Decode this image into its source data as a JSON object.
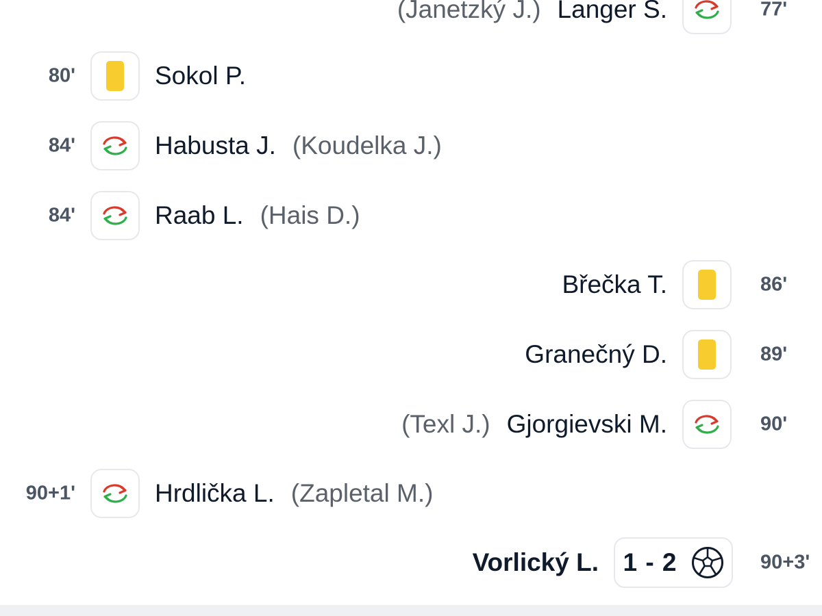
{
  "events": [
    {
      "type": "substitution",
      "side": "right",
      "time": "77'",
      "player_in": "Langer S.",
      "player_out": "(Janetzký J.)"
    },
    {
      "type": "yellow_card",
      "side": "left",
      "time": "80'",
      "player": "Sokol P."
    },
    {
      "type": "substitution",
      "side": "left",
      "time": "84'",
      "player_in": "Habusta J.",
      "player_out": "(Koudelka J.)"
    },
    {
      "type": "substitution",
      "side": "left",
      "time": "84'",
      "player_in": "Raab L.",
      "player_out": "(Hais D.)"
    },
    {
      "type": "yellow_card",
      "side": "right",
      "time": "86'",
      "player": "Břečka T."
    },
    {
      "type": "yellow_card",
      "side": "right",
      "time": "89'",
      "player": "Granečný D."
    },
    {
      "type": "substitution",
      "side": "right",
      "time": "90'",
      "player_in": "Gjorgievski M.",
      "player_out": "(Texl J.)"
    },
    {
      "type": "substitution",
      "side": "left",
      "time": "90+1'",
      "player_in": "Hrdlička L.",
      "player_out": "(Zapletal M.)"
    },
    {
      "type": "goal",
      "side": "right",
      "time": "90+3'",
      "player": "Vorlický L.",
      "score": "1 - 2"
    }
  ],
  "icons": {
    "yellow_card": "yellow-card-icon",
    "substitution": "substitution-icon",
    "goal": "soccer-ball-icon"
  },
  "colors": {
    "yellow_card": "#f7cc2f",
    "sub_out_arrow": "#d93a2b",
    "sub_in_arrow": "#2fae4a",
    "text_primary": "#0f1a2b",
    "text_secondary": "#5b616b",
    "time_text": "#4b5563"
  }
}
